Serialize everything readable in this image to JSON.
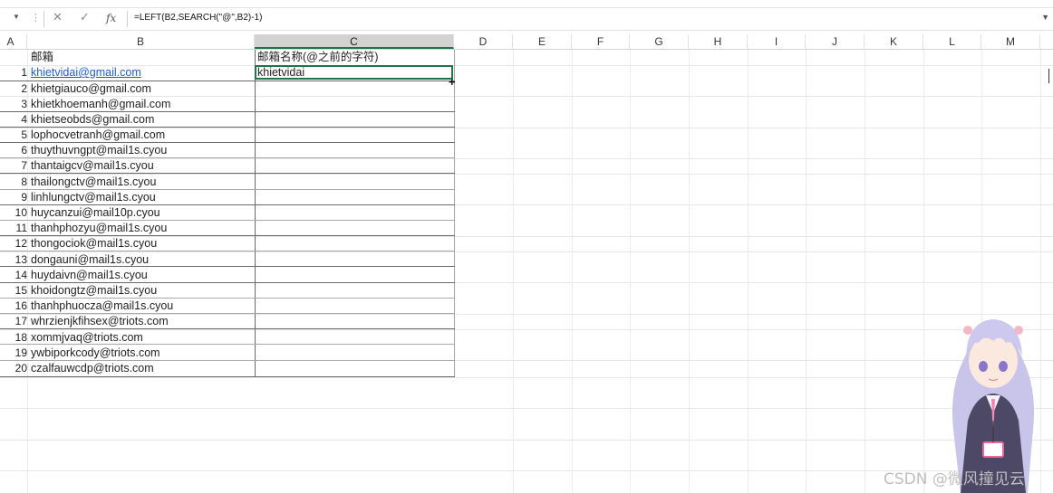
{
  "formula_bar": {
    "formula": "=LEFT(B2,SEARCH(\"@\",B2)-1)",
    "cancel_icon": "✕",
    "enter_icon": "✓",
    "fx_label": "fx"
  },
  "columns": [
    "A",
    "B",
    "C",
    "D",
    "E",
    "F",
    "G",
    "H",
    "I",
    "J",
    "K",
    "L",
    "M"
  ],
  "selected_column": "C",
  "header_row": {
    "b": "邮箱",
    "c": "邮箱名称(@之前的字符)"
  },
  "rows": [
    {
      "num": "1",
      "email": "khietvidai@gmail.com",
      "name": "khietvidai"
    },
    {
      "num": "2",
      "email": "khietgiauco@gmail.com",
      "name": ""
    },
    {
      "num": "3",
      "email": "khietkhoemanh@gmail.com",
      "name": ""
    },
    {
      "num": "4",
      "email": "khietseobds@gmail.com",
      "name": ""
    },
    {
      "num": "5",
      "email": "lophocvetranh@gmail.com",
      "name": ""
    },
    {
      "num": "6",
      "email": "thuythuvngpt@mail1s.cyou",
      "name": ""
    },
    {
      "num": "7",
      "email": "thantaigcv@mail1s.cyou",
      "name": ""
    },
    {
      "num": "8",
      "email": "thailongctv@mail1s.cyou",
      "name": ""
    },
    {
      "num": "9",
      "email": "linhlungctv@mail1s.cyou",
      "name": ""
    },
    {
      "num": "10",
      "email": "huycanzui@mail10p.cyou",
      "name": ""
    },
    {
      "num": "11",
      "email": "thanhphozyu@mail1s.cyou",
      "name": ""
    },
    {
      "num": "12",
      "email": "thongociok@mail1s.cyou",
      "name": ""
    },
    {
      "num": "13",
      "email": "dongauni@mail1s.cyou",
      "name": ""
    },
    {
      "num": "14",
      "email": "huydaivn@mail1s.cyou",
      "name": ""
    },
    {
      "num": "15",
      "email": "khoidongtz@mail1s.cyou",
      "name": ""
    },
    {
      "num": "16",
      "email": "thanhphuocza@mail1s.cyou",
      "name": ""
    },
    {
      "num": "17",
      "email": "whrzienjkfihsex@triots.com",
      "name": ""
    },
    {
      "num": "18",
      "email": "xommjvaq@triots.com",
      "name": ""
    },
    {
      "num": "19",
      "email": "ywbiporkcody@triots.com",
      "name": ""
    },
    {
      "num": "20",
      "email": "czalfauwcdp@triots.com",
      "name": ""
    }
  ],
  "watermark": "CSDN @微风撞见云",
  "accent_color": "#217346",
  "link_color": "#1f5fbf"
}
